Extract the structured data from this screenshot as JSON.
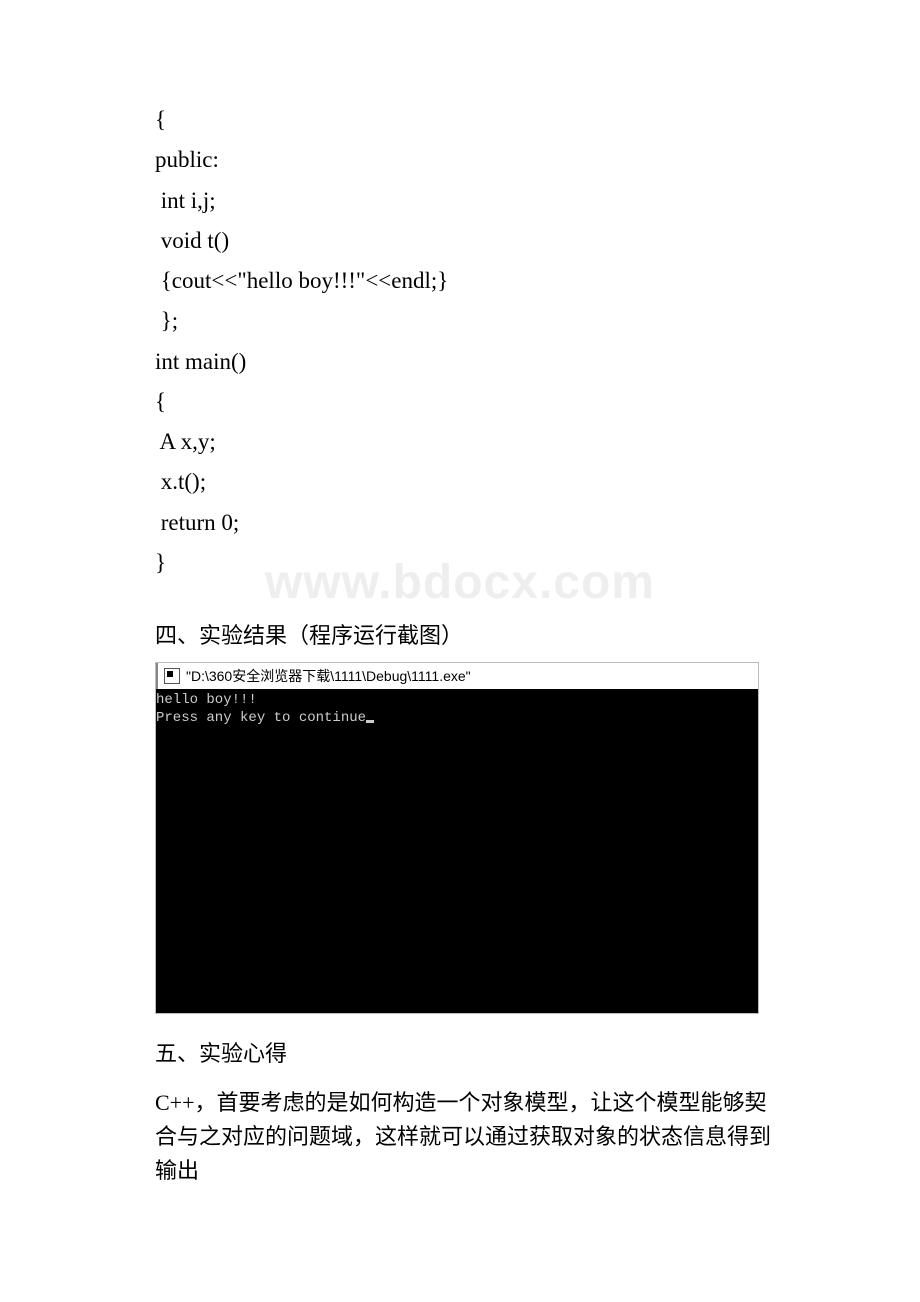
{
  "code": {
    "lines": [
      "{",
      "public:",
      " int i,j;",
      " void t()",
      " {cout<<\"hello boy!!!\"<<endl;}",
      " };",
      "int main()",
      "{",
      " A x,y;",
      " x.t();",
      " return 0;",
      "}"
    ]
  },
  "watermark": "www.bdocx.com",
  "section4_heading": "四、实验结果（程序运行截图）",
  "console": {
    "title": "\"D:\\360安全浏览器下载\\1111\\Debug\\1111.exe\"",
    "output_line1": "hello boy!!!",
    "output_line2": "Press any key to continue"
  },
  "section5_heading": "五、实验心得",
  "paragraph": "C++，首要考虑的是如何构造一个对象模型，让这个模型能够契合与之对应的问题域，这样就可以通过获取对象的状态信息得到输出"
}
